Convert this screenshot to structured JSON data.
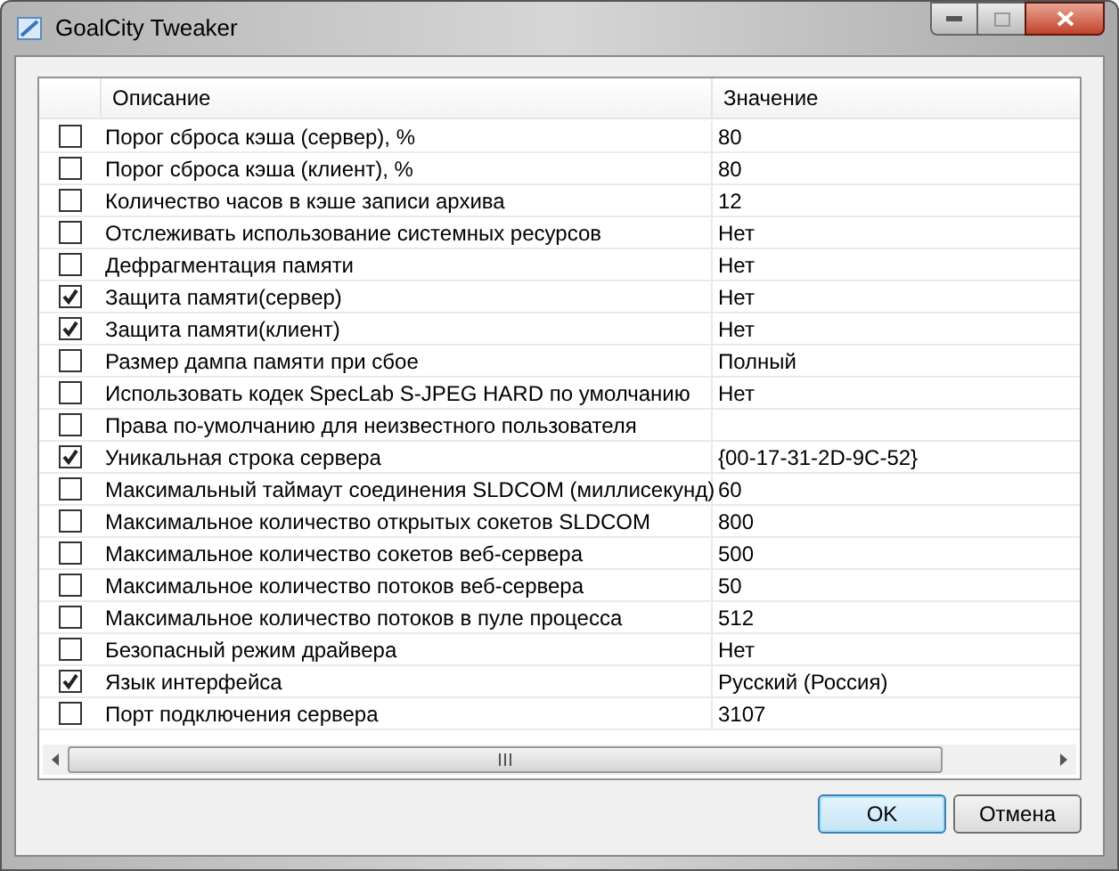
{
  "window": {
    "title": "GoalCity Tweaker"
  },
  "table": {
    "columns": [
      "Описание",
      "Значение"
    ],
    "rows": [
      {
        "checked": false,
        "description": "Порог сброса кэша (сервер), %",
        "value": "80"
      },
      {
        "checked": false,
        "description": "Порог сброса кэша (клиент), %",
        "value": "80"
      },
      {
        "checked": false,
        "description": "Количество часов в кэше записи архива",
        "value": "12"
      },
      {
        "checked": false,
        "description": "Отслеживать использование системных ресурсов",
        "value": "Нет"
      },
      {
        "checked": false,
        "description": "Дефрагментация памяти",
        "value": "Нет"
      },
      {
        "checked": true,
        "description": "Защита памяти(сервер)",
        "value": "Нет"
      },
      {
        "checked": true,
        "description": "Защита памяти(клиент)",
        "value": "Нет"
      },
      {
        "checked": false,
        "description": "Размер дампа памяти при сбое",
        "value": "Полный"
      },
      {
        "checked": false,
        "description": "Использовать кодек SpecLab S-JPEG HARD по умолчанию",
        "value": "Нет"
      },
      {
        "checked": false,
        "description": "Права по-умолчанию для неизвестного пользователя"
      },
      {
        "checked": true,
        "description": "Уникальная строка сервера",
        "value": "{00-17-31-2D-9C-52}"
      },
      {
        "checked": false,
        "description": "Максимальный таймаут соединения SLDCOM (миллисекунд)",
        "value": "60"
      },
      {
        "checked": false,
        "description": "Максимальное количество открытых сокетов SLDCOM",
        "value": "800"
      },
      {
        "checked": false,
        "description": "Максимальное количество сокетов веб-сервера",
        "value": "500"
      },
      {
        "checked": false,
        "description": "Максимальное количество потоков веб-сервера",
        "value": "50"
      },
      {
        "checked": false,
        "description": "Максимальное количество потоков в пуле процесса",
        "value": "512"
      },
      {
        "checked": false,
        "description": "Безопасный режим драйвера",
        "value": "Нет"
      },
      {
        "checked": true,
        "description": "Язык интерфейса",
        "value": "Русский (Россия)"
      },
      {
        "checked": false,
        "description": "Порт подключения сервера",
        "value": "3107"
      }
    ]
  },
  "buttons": [
    {
      "label": "OK",
      "default": true
    },
    {
      "label": "Отмена",
      "default": false
    }
  ]
}
